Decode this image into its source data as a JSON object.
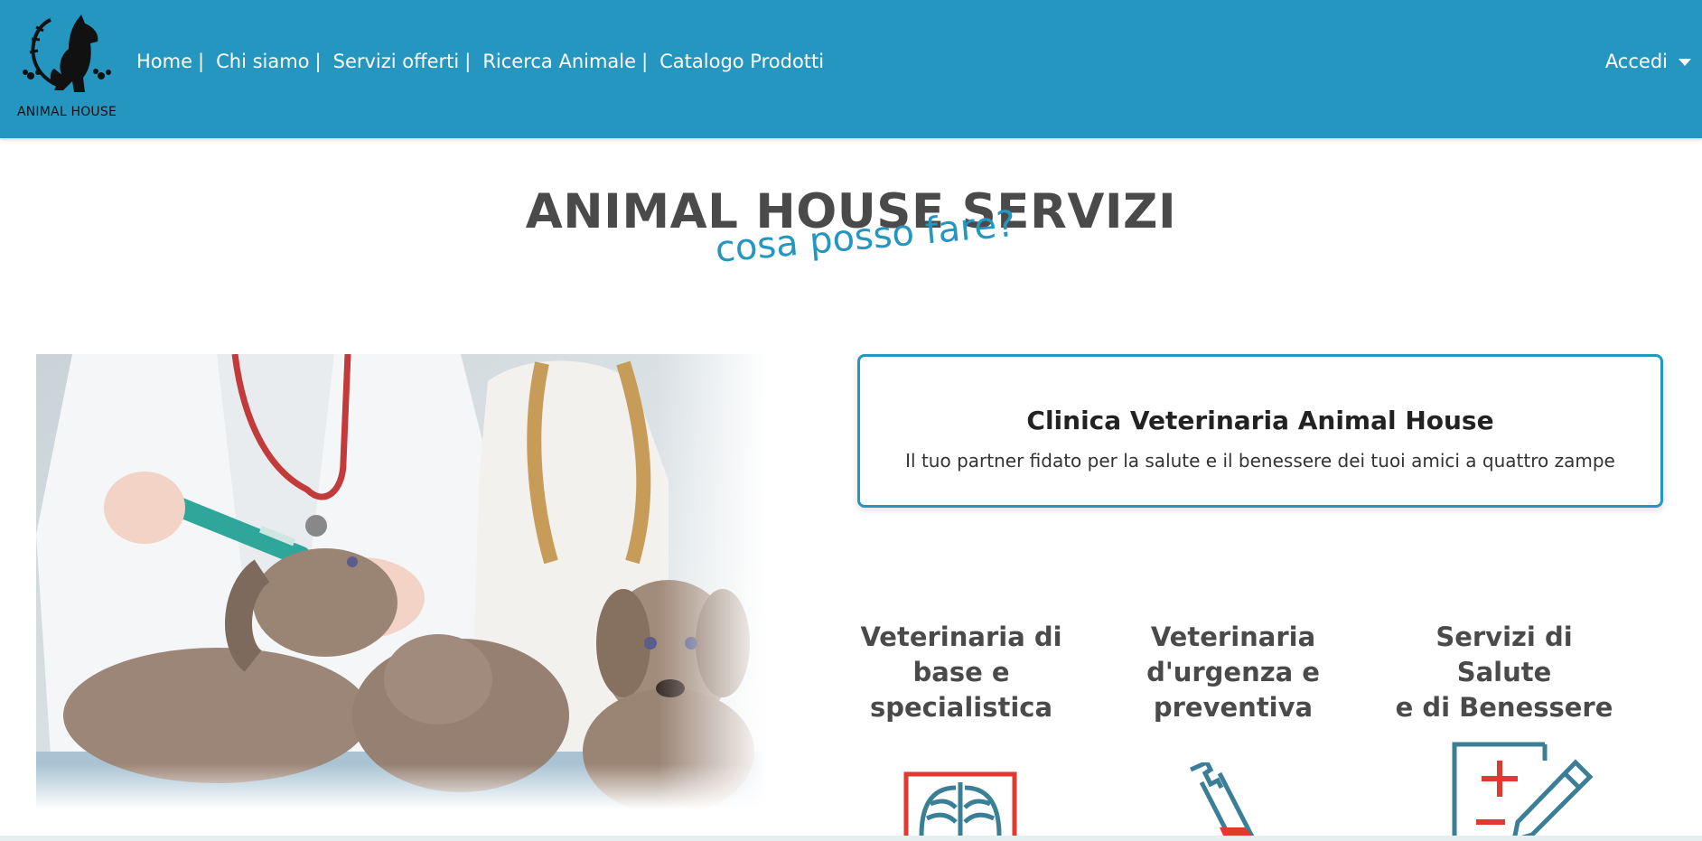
{
  "brand": {
    "logo_text": "ANIMAL HOUSE"
  },
  "nav": {
    "items": [
      {
        "label": "Home"
      },
      {
        "label": "Chi siamo"
      },
      {
        "label": "Servizi offerti"
      },
      {
        "label": "Ricerca Animale"
      },
      {
        "label": "Catalogo Prodotti"
      }
    ],
    "separator": "|",
    "login_label": "Accedi"
  },
  "hero": {
    "title": "ANIMAL HOUSE SERVIZI",
    "subtitle": "cosa posso fare?"
  },
  "clinic": {
    "title": "Clinica Veterinaria Animal House",
    "description": "Il tuo partner fidato per la salute e il benessere dei tuoi amici a quattro zampe"
  },
  "services": [
    {
      "title_lines": [
        "Veterinaria di",
        "base e",
        "specialistica"
      ],
      "icon": "xray-icon"
    },
    {
      "title_lines": [
        "Veterinaria",
        "d'urgenza e",
        "preventiva"
      ],
      "icon": "syringe-icon"
    },
    {
      "title_lines": [
        "Servizi di Salute",
        "e di Benessere"
      ],
      "icon": "medical-report-icon"
    }
  ],
  "colors": {
    "primary": "#2596c0",
    "text_dark": "#4a4a4a",
    "icon_red": "#e0392f",
    "icon_teal": "#3a7f96"
  }
}
